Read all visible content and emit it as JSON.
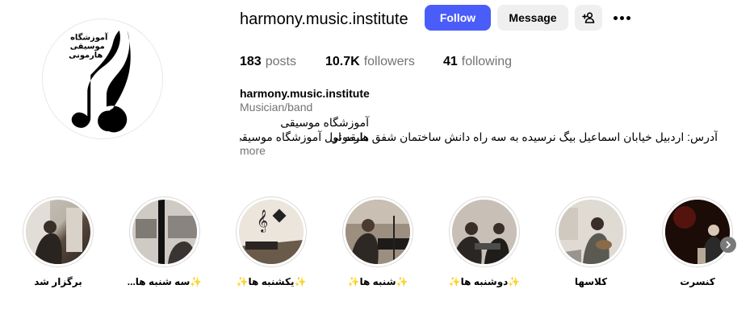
{
  "profile": {
    "username": "harmony.music.institute",
    "logo_text": [
      "آموزشگاه",
      "موسیقی",
      "هارمونی"
    ]
  },
  "actions": {
    "follow_label": "Follow",
    "message_label": "Message",
    "suggest_icon": "add-person-icon",
    "more_icon": "more-horizontal-icon"
  },
  "stats": {
    "posts_count": "183",
    "posts_label": "posts",
    "followers_count": "10.7K",
    "followers_label": "followers",
    "following_count": "41",
    "following_label": "following"
  },
  "bio": {
    "name": "harmony.music.institute",
    "category": "Musician/band",
    "line1": "آموزشگاه موسیقی هارمونی",
    "line2": "آدرس: اردبیل خیابان اسماعیل بیگ نرسیده به سه راه دانش ساختمان شفق طبقه اول آموزشگاه موسیقی...",
    "more_label": "more"
  },
  "highlights": [
    {
      "label": "برگزار شد"
    },
    {
      "label": "✨سه شنبه ها..."
    },
    {
      "label": "✨یکشنبه ها✨"
    },
    {
      "label": "✨شنبه ها✨"
    },
    {
      "label": "✨دوشنبه ها✨"
    },
    {
      "label": "کلاسها"
    },
    {
      "label": "کنسرت"
    }
  ],
  "colors": {
    "follow_button": "#4a5df9",
    "secondary_button": "#efefef",
    "muted_text": "#737373"
  }
}
